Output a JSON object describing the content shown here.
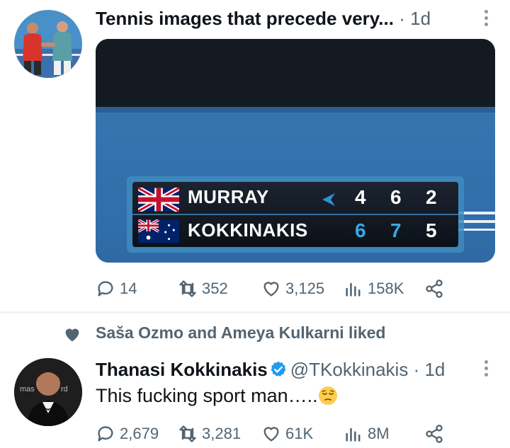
{
  "tweet1": {
    "display_name": "Tennis images that precede very...",
    "separator": "·",
    "time": "1d",
    "scoreboard": {
      "players": [
        {
          "name": "MURRAY",
          "flag": "united-kingdom-flag",
          "serving": true,
          "sets": [
            "4",
            "6",
            "2"
          ]
        },
        {
          "name": "KOKKINAKIS",
          "flag": "australia-flag",
          "serving": false,
          "sets": [
            "6",
            "7",
            "5"
          ]
        }
      ],
      "colors": {
        "set_white": "#ffffff",
        "set_blue": "#3aa7e6",
        "server_arrow": "#2f8fd4"
      }
    },
    "stats": {
      "replies": "14",
      "retweets": "352",
      "likes": "3,125",
      "views": "158K"
    }
  },
  "tweet2": {
    "social_context": "Saša Ozmo and Ameya Kulkarni liked",
    "display_name": "Thanasi Kokkinakis",
    "handle": "@TKokkinakis",
    "separator": "·",
    "time": "1d",
    "text": "This fucking sport man…..",
    "text_emoji": "pensive-face-emoji",
    "avatar_backdrop_text_left": "mas",
    "avatar_backdrop_text_right": "rd",
    "stats": {
      "replies": "2,679",
      "retweets": "3,281",
      "likes": "61K",
      "views": "8M"
    }
  },
  "colors": {
    "text": "#0f1419",
    "muted": "#536471",
    "verified": "#1d9bf0",
    "divider": "#eff3f4"
  }
}
